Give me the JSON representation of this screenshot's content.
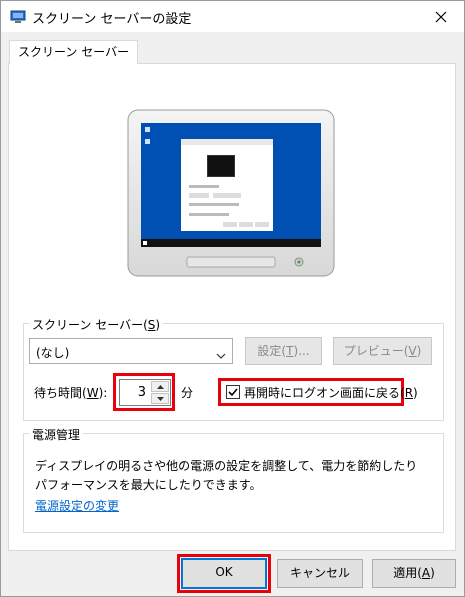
{
  "window": {
    "title": "スクリーン セーバーの設定"
  },
  "tab": {
    "label": "スクリーン セーバー"
  },
  "screensaver_group": {
    "title": "スクリーン セーバー(S)",
    "title_main": "スクリーン セーバー(",
    "title_key": "S",
    "title_end": ")",
    "selected": "(なし)",
    "settings_button": {
      "main": "設定(",
      "key": "T",
      "end": ")..."
    },
    "preview_button": {
      "main": "プレビュー(",
      "key": "V",
      "end": ")"
    },
    "wait_label": {
      "main": "待ち時間(",
      "key": "W",
      "end": "):"
    },
    "wait_value": "3",
    "wait_unit": "分",
    "logon_checkbox": {
      "main": "再開時にログオン画面に戻る(",
      "key": "R",
      "end": ")",
      "checked": true
    }
  },
  "power_group": {
    "title": "電源管理",
    "description_line1": "ディスプレイの明るさや他の電源の設定を調整して、電力を節約したり",
    "description_line2": "パフォーマンスを最大にしたりできます。",
    "link": "電源設定の変更"
  },
  "buttons": {
    "ok": "OK",
    "cancel": "キャンセル",
    "apply": {
      "main": "適用(",
      "key": "A",
      "end": ")"
    }
  },
  "colors": {
    "highlight": "#e8000b",
    "link": "#0066cc",
    "desktop": "#0050b3"
  }
}
